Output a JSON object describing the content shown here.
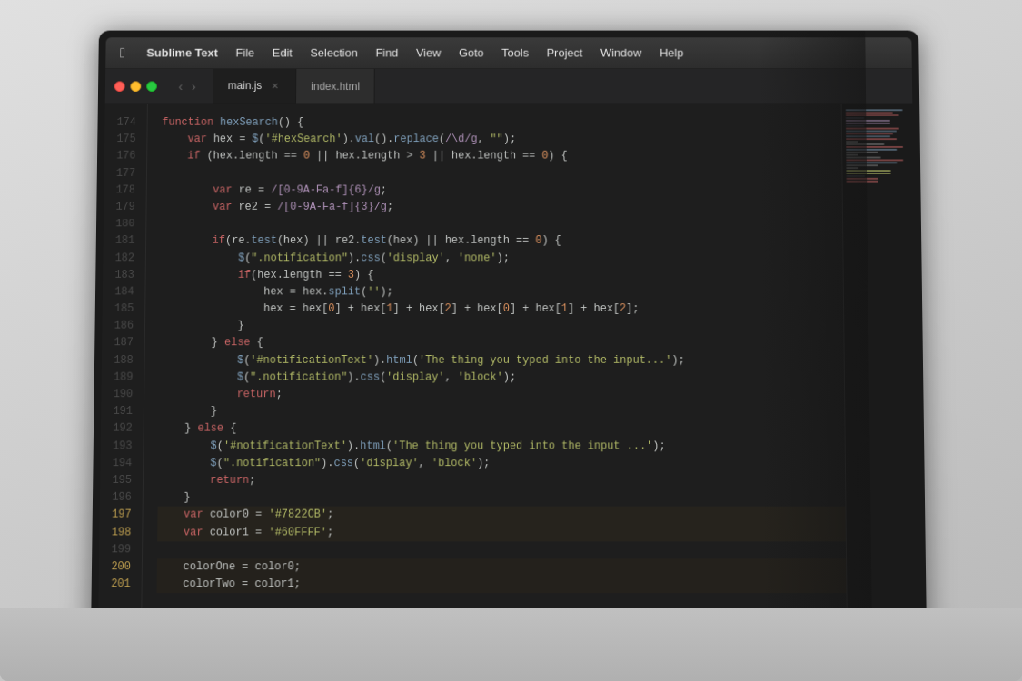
{
  "menubar": {
    "apple_icon": "",
    "items": [
      {
        "label": "Sublime Text",
        "bold": true
      },
      {
        "label": "File"
      },
      {
        "label": "Edit"
      },
      {
        "label": "Selection"
      },
      {
        "label": "Find"
      },
      {
        "label": "View"
      },
      {
        "label": "Goto"
      },
      {
        "label": "Tools"
      },
      {
        "label": "Project"
      },
      {
        "label": "Window"
      },
      {
        "label": "Help"
      }
    ]
  },
  "tabs": [
    {
      "label": "main.js",
      "active": true
    },
    {
      "label": "index.html",
      "active": false
    }
  ],
  "code": {
    "lines": [
      {
        "num": "174",
        "content": "function hexSearch() {",
        "highlighted": false
      },
      {
        "num": "175",
        "content": "    var hex = $('#hexSearch').val().replace(/\\d/g, \"\");",
        "highlighted": false
      },
      {
        "num": "176",
        "content": "    if (hex.length == 0 || hex.length > 3 || hex.length == 0) {",
        "highlighted": false
      },
      {
        "num": "177",
        "content": "",
        "highlighted": false
      },
      {
        "num": "178",
        "content": "        var re = /[0-9A-Fa-f]{6}/g;",
        "highlighted": false
      },
      {
        "num": "179",
        "content": "        var re2 = /[0-9A-Fa-f]{3}/g;",
        "highlighted": false
      },
      {
        "num": "180",
        "content": "",
        "highlighted": false
      },
      {
        "num": "181",
        "content": "        if(re.test(hex) || re2.test(hex) || hex.length == 0) {",
        "highlighted": false
      },
      {
        "num": "182",
        "content": "            $(\".notification\").css('display', 'none');",
        "highlighted": false
      },
      {
        "num": "183",
        "content": "            if(hex.length == 3) {",
        "highlighted": false
      },
      {
        "num": "184",
        "content": "                hex = hex.split('');",
        "highlighted": false
      },
      {
        "num": "185",
        "content": "                hex = hex[0] + hex[1] + hex[2] + hex[0] + hex[1] + hex[2];",
        "highlighted": false
      },
      {
        "num": "186",
        "content": "            }",
        "highlighted": false
      },
      {
        "num": "187",
        "content": "        } else {",
        "highlighted": false
      },
      {
        "num": "188",
        "content": "            $('#notificationText').html('The thing you typed into the input...');",
        "highlighted": false
      },
      {
        "num": "189",
        "content": "            $(\".notification\").css('display', 'block');",
        "highlighted": false
      },
      {
        "num": "190",
        "content": "            return;",
        "highlighted": false
      },
      {
        "num": "191",
        "content": "        }",
        "highlighted": false
      },
      {
        "num": "192",
        "content": "    } else {",
        "highlighted": false
      },
      {
        "num": "193",
        "content": "        $('#notificationText').html('The thing you typed into the input ...');",
        "highlighted": false
      },
      {
        "num": "194",
        "content": "        $(\".notification\").css('display', 'block');",
        "highlighted": false
      },
      {
        "num": "195",
        "content": "        return;",
        "highlighted": false
      },
      {
        "num": "196",
        "content": "    }",
        "highlighted": false
      },
      {
        "num": "197",
        "content": "    var color0 = '#7822CB';",
        "highlighted": true
      },
      {
        "num": "198",
        "content": "    var color1 = '#60FFFF';",
        "highlighted": true
      },
      {
        "num": "199",
        "content": "",
        "highlighted": false
      },
      {
        "num": "200",
        "content": "    colorOne = color0;",
        "highlighted": true
      },
      {
        "num": "201",
        "content": "    colorTwo = color1;",
        "highlighted": true
      }
    ]
  }
}
